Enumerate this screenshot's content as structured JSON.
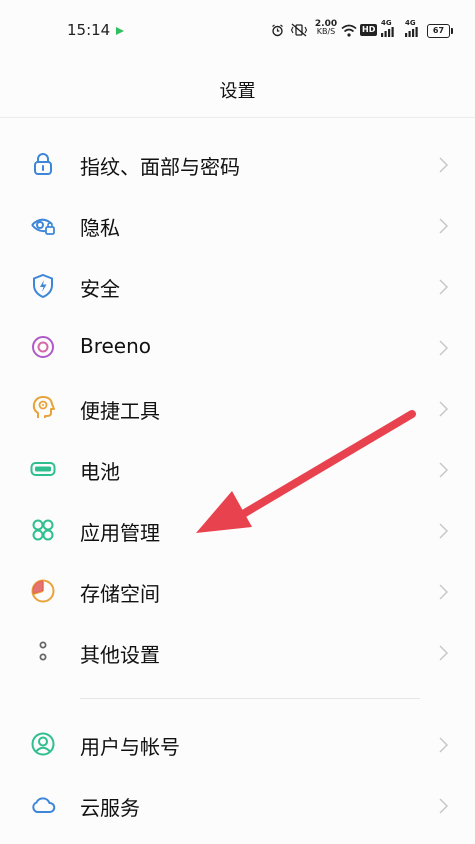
{
  "status_bar": {
    "time": "15:14",
    "network_speed_value": "2.00",
    "network_speed_unit": "KB/S",
    "hd_label": "HD",
    "signal_1_label": "4G",
    "signal_2_label": "4G",
    "battery_level": "67"
  },
  "header": {
    "title": "设置"
  },
  "settings": {
    "items": [
      {
        "label": "指纹、面部与密码",
        "icon": "lock-icon",
        "color": "#3d86d8"
      },
      {
        "label": "隐私",
        "icon": "privacy-eye-icon",
        "color": "#3d86d8"
      },
      {
        "label": "安全",
        "icon": "shield-icon",
        "color": "#3d86d8"
      },
      {
        "label": "Breeno",
        "icon": "breeno-icon",
        "color": "#b05ac9"
      },
      {
        "label": "便捷工具",
        "icon": "tools-head-icon",
        "color": "#e8a33a"
      },
      {
        "label": "电池",
        "icon": "battery-icon",
        "color": "#2fbf8f"
      },
      {
        "label": "应用管理",
        "icon": "apps-icon",
        "color": "#2fbf8f"
      },
      {
        "label": "存储空间",
        "icon": "storage-pie-icon",
        "color": "#e8a33a"
      },
      {
        "label": "其他设置",
        "icon": "more-dots-icon",
        "color": "#666666"
      },
      {
        "label": "用户与帐号",
        "icon": "user-icon",
        "color": "#2fbf8f"
      },
      {
        "label": "云服务",
        "icon": "cloud-icon",
        "color": "#3d86d8"
      }
    ]
  },
  "annotation": {
    "arrow_color": "#e8424f"
  }
}
